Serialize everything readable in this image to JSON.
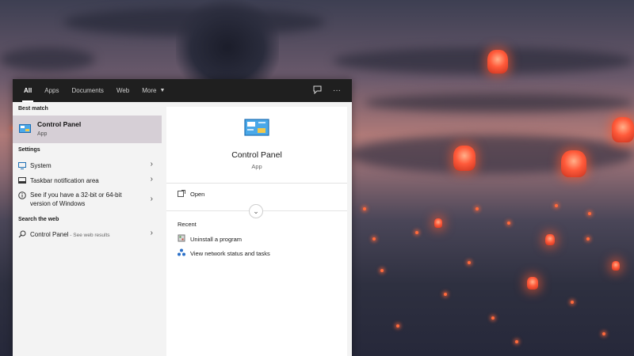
{
  "tabs": [
    {
      "label": "All",
      "active": true
    },
    {
      "label": "Apps"
    },
    {
      "label": "Documents"
    },
    {
      "label": "Web"
    },
    {
      "label": "More"
    }
  ],
  "topbar_icons": [
    "feedback-icon",
    "more-options-icon"
  ],
  "left": {
    "best_match_label": "Best match",
    "best_match": {
      "title": "Control Panel",
      "subtitle": "App",
      "icon": "control-panel-icon"
    },
    "settings_label": "Settings",
    "settings": [
      {
        "label": "System",
        "icon": "monitor-icon"
      },
      {
        "label": "Taskbar notification area",
        "icon": "taskbar-icon"
      },
      {
        "label": "See if you have a 32-bit or 64-bit version of Windows",
        "line1": "See if you have a 32-bit or 64-bit",
        "line2": "version of Windows",
        "icon": "info-icon"
      }
    ],
    "web_label": "Search the web",
    "web": {
      "label": "Control Panel",
      "sub": " - See web results",
      "icon": "search-icon"
    }
  },
  "right": {
    "title": "Control Panel",
    "type": "App",
    "open_label": "Open",
    "recent_label": "Recent",
    "recent": [
      {
        "label": "Uninstall a program",
        "icon": "programs-icon"
      },
      {
        "label": "View network status and tasks",
        "icon": "network-icon"
      }
    ]
  },
  "colors": {
    "topbar": "#1f1f1f",
    "selected": "#d6cfd6",
    "panel": "#f3f3f3"
  }
}
